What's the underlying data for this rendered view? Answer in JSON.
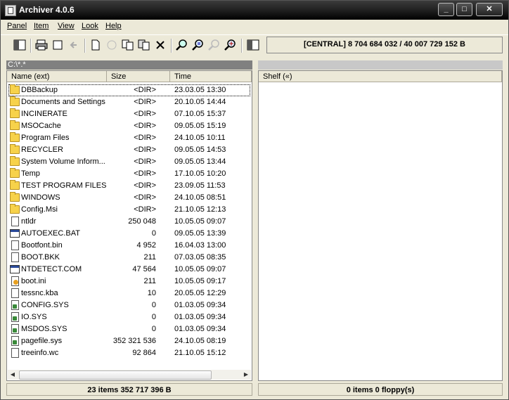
{
  "window": {
    "title": "Archiver 4.0.6",
    "minimize": "_",
    "maximize": "□",
    "close": "✕"
  },
  "menu": [
    {
      "label": "Panel"
    },
    {
      "label": "Item"
    },
    {
      "label": "View"
    },
    {
      "label": "Look"
    },
    {
      "label": "Help"
    }
  ],
  "toolbar": {
    "info_text": "[CENTRAL] 8 704 684 032 / 40 007 729 152 B"
  },
  "left_panel": {
    "path": "C:\\*.*",
    "columns": [
      "Name (ext)",
      "Size",
      "Time"
    ],
    "rows": [
      {
        "name": "DBBackup",
        "size": "<DIR>",
        "time": "23.03.05 13:30",
        "icon": "folder-icon"
      },
      {
        "name": "Documents and Settings",
        "size": "<DIR>",
        "time": "20.10.05 14:44",
        "icon": "folder-icon"
      },
      {
        "name": "INCINERATE",
        "size": "<DIR>",
        "time": "07.10.05 15:37",
        "icon": "folder-icon"
      },
      {
        "name": "MSOCache",
        "size": "<DIR>",
        "time": "09.05.05 15:19",
        "icon": "folder-icon"
      },
      {
        "name": "Program Files",
        "size": "<DIR>",
        "time": "24.10.05 10:11",
        "icon": "folder-icon"
      },
      {
        "name": "RECYCLER",
        "size": "<DIR>",
        "time": "09.05.05 14:53",
        "icon": "folder-icon"
      },
      {
        "name": "System Volume Inform...",
        "size": "<DIR>",
        "time": "09.05.05 13:44",
        "icon": "folder-icon"
      },
      {
        "name": "Temp",
        "size": "<DIR>",
        "time": "17.10.05 10:20",
        "icon": "folder-icon"
      },
      {
        "name": "TEST PROGRAM FILES",
        "size": "<DIR>",
        "time": "23.09.05 11:53",
        "icon": "folder-icon"
      },
      {
        "name": "WINDOWS",
        "size": "<DIR>",
        "time": "24.10.05 08:51",
        "icon": "folder-icon"
      },
      {
        "name": "Config.Msi",
        "size": "<DIR>",
        "time": "21.10.05 12:13",
        "icon": "folder-icon"
      },
      {
        "name": "ntldr",
        "size": "250 048",
        "time": "10.05.05 09:07",
        "icon": "file-icon"
      },
      {
        "name": "AUTOEXEC.BAT",
        "size": "0",
        "time": "09.05.05 13:39",
        "icon": "exe-icon"
      },
      {
        "name": "Bootfont.bin",
        "size": "4 952",
        "time": "16.04.03 13:00",
        "icon": "file-icon"
      },
      {
        "name": "BOOT.BKK",
        "size": "211",
        "time": "07.03.05 08:35",
        "icon": "file-icon"
      },
      {
        "name": "NTDETECT.COM",
        "size": "47 564",
        "time": "10.05.05 09:07",
        "icon": "exe-icon"
      },
      {
        "name": "boot.ini",
        "size": "211",
        "time": "10.05.05 09:17",
        "icon": "ini-icon"
      },
      {
        "name": "tessnc.kba",
        "size": "10",
        "time": "20.05.05 12:29",
        "icon": "file-icon"
      },
      {
        "name": "CONFIG.SYS",
        "size": "0",
        "time": "01.03.05 09:34",
        "icon": "sys-icon"
      },
      {
        "name": "IO.SYS",
        "size": "0",
        "time": "01.03.05 09:34",
        "icon": "sys-icon"
      },
      {
        "name": "MSDOS.SYS",
        "size": "0",
        "time": "01.03.05 09:34",
        "icon": "sys-icon"
      },
      {
        "name": "pagefile.sys",
        "size": "352 321 536",
        "time": "24.10.05 08:19",
        "icon": "sys-icon"
      },
      {
        "name": "treeinfo.wc",
        "size": "92 864",
        "time": "21.10.05 15:12",
        "icon": "file-icon"
      }
    ],
    "status": "23 items 352 717 396 B"
  },
  "right_panel": {
    "columns": [
      "Shelf («)"
    ],
    "status": "0 items 0 floppy(s)"
  }
}
